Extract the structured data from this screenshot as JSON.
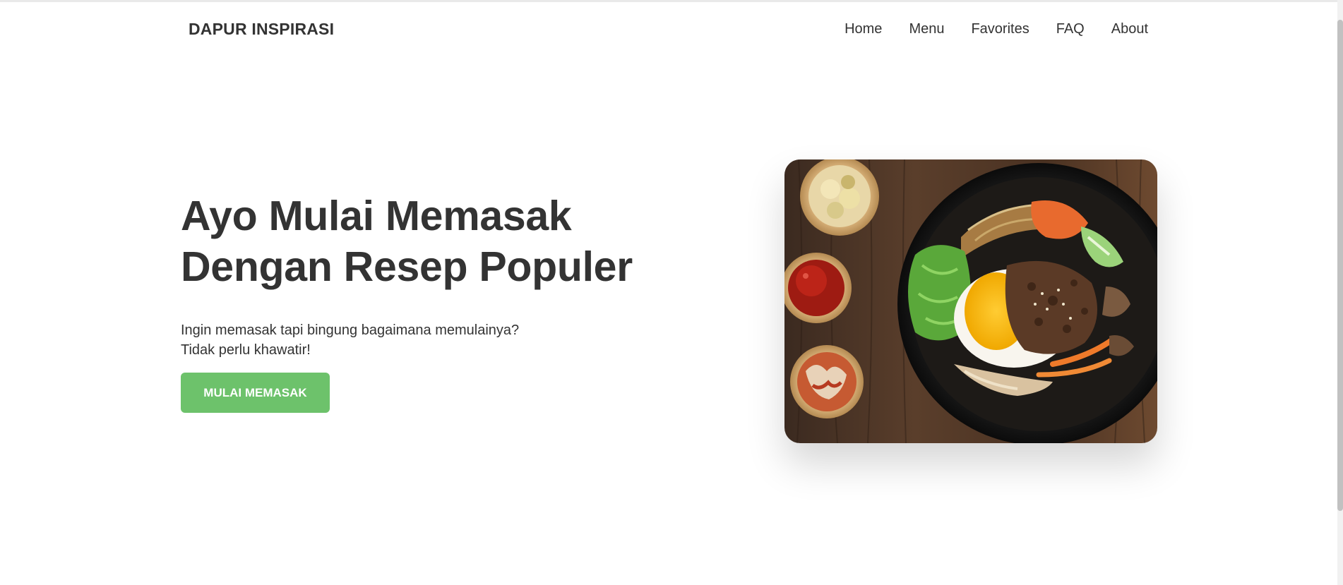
{
  "brand": {
    "name": "DAPUR INSPIRASI"
  },
  "nav": {
    "items": [
      {
        "label": "Home"
      },
      {
        "label": "Menu"
      },
      {
        "label": "Favorites"
      },
      {
        "label": "FAQ"
      },
      {
        "label": "About"
      }
    ]
  },
  "hero": {
    "title_line1": "Ayo Mulai Memasak",
    "title_line2": "Dengan Resep Populer",
    "subtitle_line1": "Ingin memasak tapi bingung bagaimana memulainya?",
    "subtitle_line2": "Tidak perlu khawatir!",
    "cta_label": "MULAI MEMASAK",
    "image_alt": "bibimbap"
  },
  "colors": {
    "text": "#333333",
    "cta": "#6dc26b",
    "cta_text": "#ffffff",
    "background": "#ffffff"
  }
}
